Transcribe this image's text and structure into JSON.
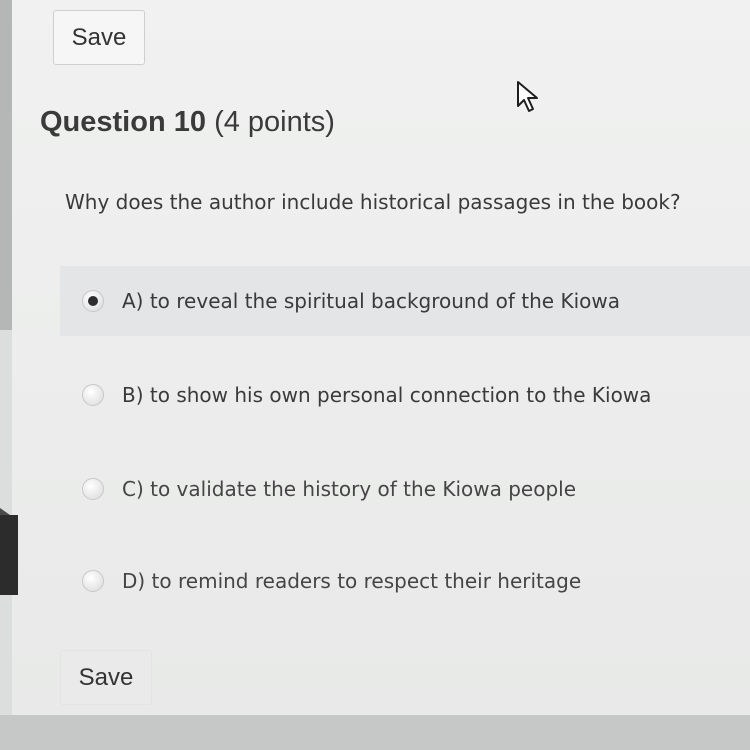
{
  "toolbar": {
    "save_label_top": "Save",
    "save_label_bottom": "Save"
  },
  "question": {
    "title": "Question 10",
    "points": "(4 points)",
    "prompt": "Why does the author include historical passages in the book?"
  },
  "options": [
    {
      "label": "A) to reveal the spiritual background of the Kiowa",
      "selected": true
    },
    {
      "label": "B) to show his own personal connection to the Kiowa",
      "selected": false
    },
    {
      "label": "C) to validate the history of the Kiowa people",
      "selected": false
    },
    {
      "label": "D) to remind readers to respect their heritage",
      "selected": false
    }
  ],
  "icons": {
    "cursor": "mouse-pointer-icon"
  },
  "colors": {
    "page_background": "#f0f1f0",
    "selected_row": "#e3e5e6",
    "text": "#3a3a3a"
  }
}
